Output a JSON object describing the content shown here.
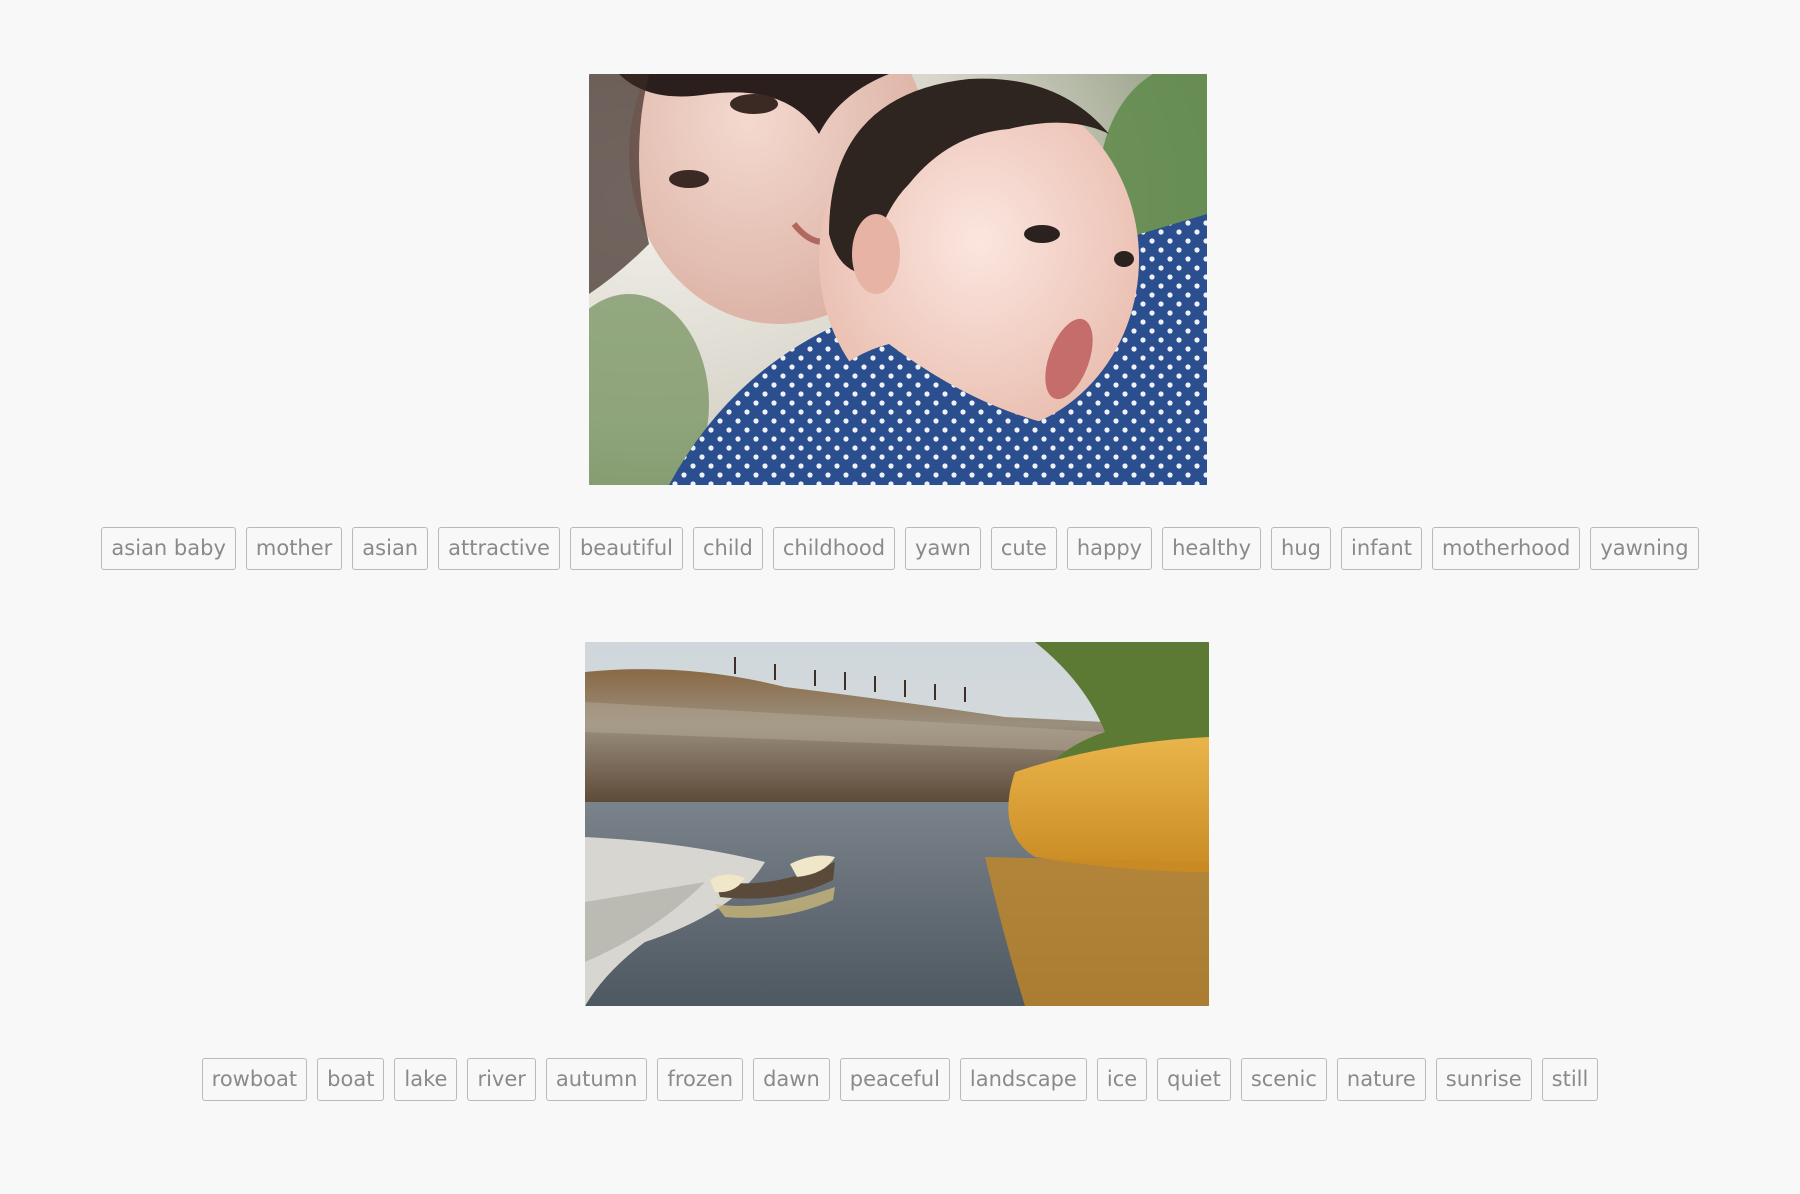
{
  "images": [
    {
      "icon": "mother-and-baby-photo",
      "tags": [
        "asian baby",
        "mother",
        "asian",
        "attractive",
        "beautiful",
        "child",
        "childhood",
        "yawn",
        "cute",
        "happy",
        "healthy",
        "hug",
        "infant",
        "motherhood",
        "yawning"
      ]
    },
    {
      "icon": "rowboat-lake-photo",
      "tags": [
        "rowboat",
        "boat",
        "lake",
        "river",
        "autumn",
        "frozen",
        "dawn",
        "peaceful",
        "landscape",
        "ice",
        "quiet",
        "scenic",
        "nature",
        "sunrise",
        "still"
      ]
    }
  ],
  "colors": {
    "background": "#f8f8f8",
    "tag_border": "#b9b9b9",
    "tag_text": "#8a8a8a"
  }
}
